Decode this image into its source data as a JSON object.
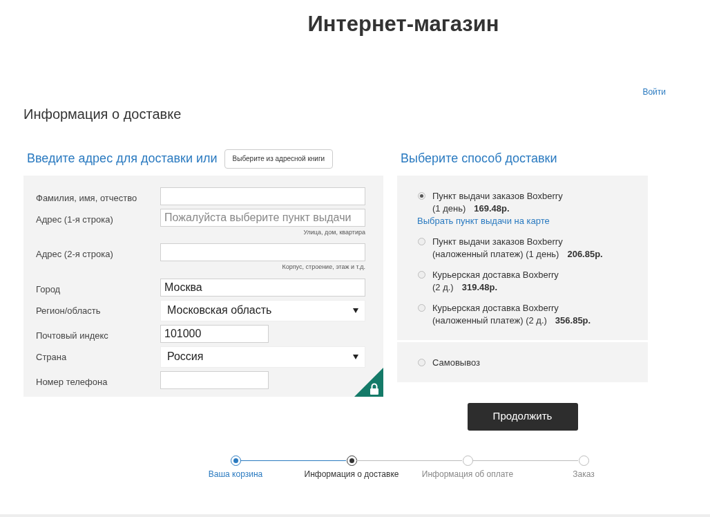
{
  "header": {
    "title": "Интернет-магазин",
    "login": "Войти"
  },
  "section_title": "Информация о доставке",
  "address": {
    "heading": "Введите адрес для доставки или",
    "book_button": "Выберите из адресной книги",
    "fields": [
      {
        "kind": "text",
        "label": "Фамилия, имя, отчество"
      },
      {
        "kind": "text",
        "label": "Адрес (1-я строка)",
        "placeholder": "Пожалуйста выберите пункт выдачи",
        "hint": "Улица, дом, квартира"
      },
      {
        "kind": "text",
        "label": "Адрес (2-я строка)",
        "hint": "Корпус, строение, этаж и т.д."
      },
      {
        "kind": "text",
        "label": "Город",
        "value": "Москва"
      },
      {
        "kind": "select",
        "label": "Регион/область",
        "value": "Московская область"
      },
      {
        "kind": "short",
        "label": "Почтовый индекс",
        "value": "101000"
      },
      {
        "kind": "select",
        "label": "Страна",
        "value": "Россия"
      },
      {
        "kind": "short",
        "label": "Номер телефона"
      }
    ]
  },
  "shipping": {
    "heading": "Выберите способ доставки",
    "panels": [
      {
        "options": [
          {
            "name": "Пункт выдачи заказов Boxberry",
            "detail": "(1 день)",
            "price": "169.48р.",
            "selected": true,
            "link": "Выбрать пункт выдачи на карте"
          },
          {
            "name": "Пункт выдачи заказов Boxberry",
            "detail": "(наложенный платеж) (1 день)",
            "price": "206.85р.",
            "selected": false
          },
          {
            "name": "Курьерская доставка Boxberry",
            "detail": "(2 д.)",
            "price": "319.48р.",
            "selected": false
          },
          {
            "name": "Курьерская доставка Boxberry",
            "detail": "(наложенный платеж) (2 д.)",
            "price": "356.85р.",
            "selected": false
          }
        ]
      },
      {
        "options": [
          {
            "name": "Самовывоз",
            "selected": false
          }
        ]
      }
    ]
  },
  "continue_button": "Продолжить",
  "steps": [
    {
      "label": "Ваша корзина",
      "kind": "done"
    },
    {
      "label": "Информация о доставке",
      "kind": "current"
    },
    {
      "label": "Информация об оплате",
      "kind": "todo"
    },
    {
      "label": "Заказ",
      "kind": "todo"
    }
  ]
}
